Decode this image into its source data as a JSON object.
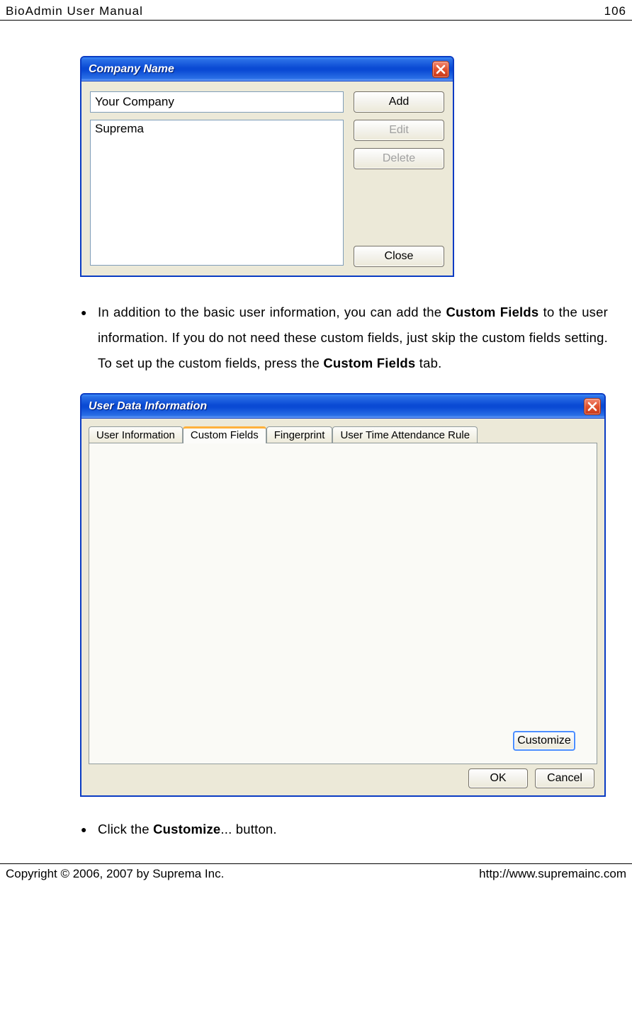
{
  "header": {
    "title": "BioAdmin User Manual",
    "page_number": "106"
  },
  "dialog1": {
    "title": "Company Name",
    "input_value": "Your Company",
    "list_item": "Suprema",
    "buttons": {
      "add": "Add",
      "edit": "Edit",
      "delete": "Delete",
      "close": "Close"
    }
  },
  "paragraph1": {
    "pre": "In addition to the basic user information, you can add the ",
    "bold1": "Custom Fields",
    "mid": " to the user information. If you do not need these custom fields, just skip the custom fields setting. To set up the custom fields, press the ",
    "bold2": "Custom Fields",
    "post": " tab."
  },
  "dialog2": {
    "title": "User Data Information",
    "tabs": {
      "t1": "User Information",
      "t2": "Custom Fields",
      "t3": "Fingerprint",
      "t4": "User Time Attendance Rule"
    },
    "customize": "Customize",
    "ok": "OK",
    "cancel": "Cancel"
  },
  "paragraph2": {
    "pre": "Click the ",
    "bold": "Customize",
    "post": "... button."
  },
  "footer": {
    "copyright": "Copyright © 2006, 2007 by Suprema Inc.",
    "url": "http://www.supremainc.com"
  }
}
